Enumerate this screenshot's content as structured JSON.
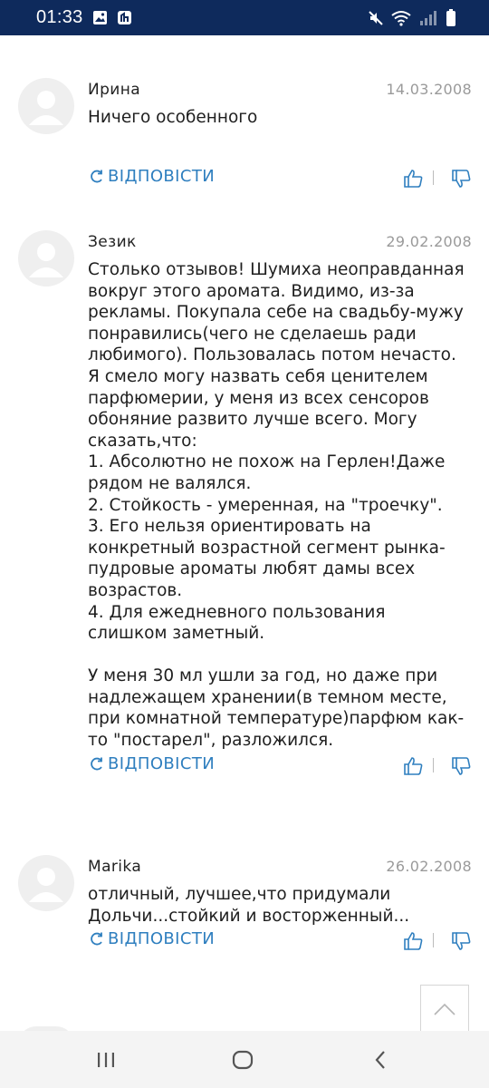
{
  "status_bar": {
    "time": "01:33",
    "icons": [
      "gallery-icon",
      "notification-icon",
      "mute-icon",
      "wifi-icon",
      "signal-icon",
      "battery-icon"
    ]
  },
  "comments": [
    {
      "author": "Ирина",
      "date": "14.03.2008",
      "text": "Ничего особенного",
      "reply_label": "ВІДПОВІСТИ"
    },
    {
      "author": "Зезик",
      "date": "29.02.2008",
      "text": "Столько отзывов! Шумиха неоправданная\nвокруг этого аромата. Видимо, из-за\nрекламы. Покупала себе на свадьбу-мужу\nпонравились(чего не сделаешь ради\nлюбимого). Пользовалась потом нечасто.\nЯ смело могу назвать себя ценителем\nпарфюмерии, у меня из всех сенсоров\nобоняние развито лучше всего. Могу\nсказать,что:\n1. Абсолютно не похож на Герлен!Даже\nрядом не валялся.\n2. Стойкость - умеренная, на \"троечку\".\n3. Его нельзя ориентировать на\nконкретный возрастной сегмент рынка-\nпудровые ароматы любят дамы всех\nвозрастов.\n4. Для ежедневного пользования\nслишком заметный.\n\nУ меня 30 мл ушли за год, но даже при\nнадлежащем хранении(в темном месте,\nпри комнатной температуре)парфюм как-\nто \"постарел\", разложился.",
      "reply_label": "ВІДПОВІСТИ"
    },
    {
      "author": "Marika",
      "date": "26.02.2008",
      "text": "отличный, лучшее,что придумали\nДольчи...стойкий и восторженный...",
      "reply_label": "ВІДПОВІСТИ"
    }
  ],
  "colors": {
    "status_bar_bg": "#0e2a5c",
    "accent_link": "#2f7fbf",
    "date_text": "#9a9a9a"
  },
  "nav_bar": {
    "buttons": [
      "recent-apps-icon",
      "home-icon",
      "back-icon"
    ]
  },
  "back_to_top_icon": "chevron-up-icon"
}
